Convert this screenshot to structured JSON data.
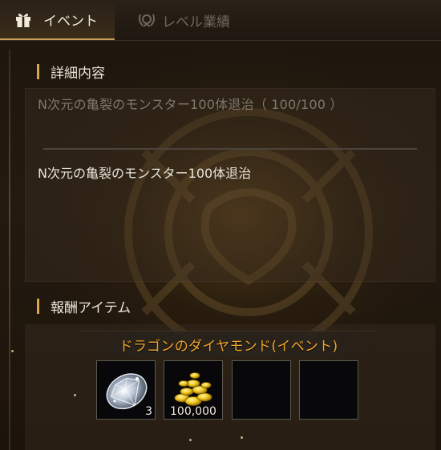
{
  "tabs": [
    {
      "id": "event",
      "label": "イベント",
      "icon": "gift-icon",
      "active": true
    },
    {
      "id": "level",
      "label": "レベル業績",
      "icon": "laurel-emblem-icon",
      "active": false
    }
  ],
  "detail": {
    "section_title": "詳細内容",
    "progress_text": "N次元の亀裂のモンスター100体退治（ 100/100 ）",
    "description": "N次元の亀裂のモンスター100体退治"
  },
  "reward": {
    "section_title": "報酬アイテム",
    "item_name": "ドラゴンのダイヤモンド(イベント)",
    "slots": [
      {
        "item": "diamond-icon",
        "quantity": "3"
      },
      {
        "item": "gold-coins-icon",
        "quantity": "100,000"
      },
      {
        "item": null,
        "quantity": ""
      },
      {
        "item": null,
        "quantity": ""
      }
    ]
  },
  "colors": {
    "accent": "#d9a54d",
    "item_name": "#f0a62a",
    "active_tab_text": "#f1ead8",
    "inactive_tab_text": "#6f685c"
  }
}
